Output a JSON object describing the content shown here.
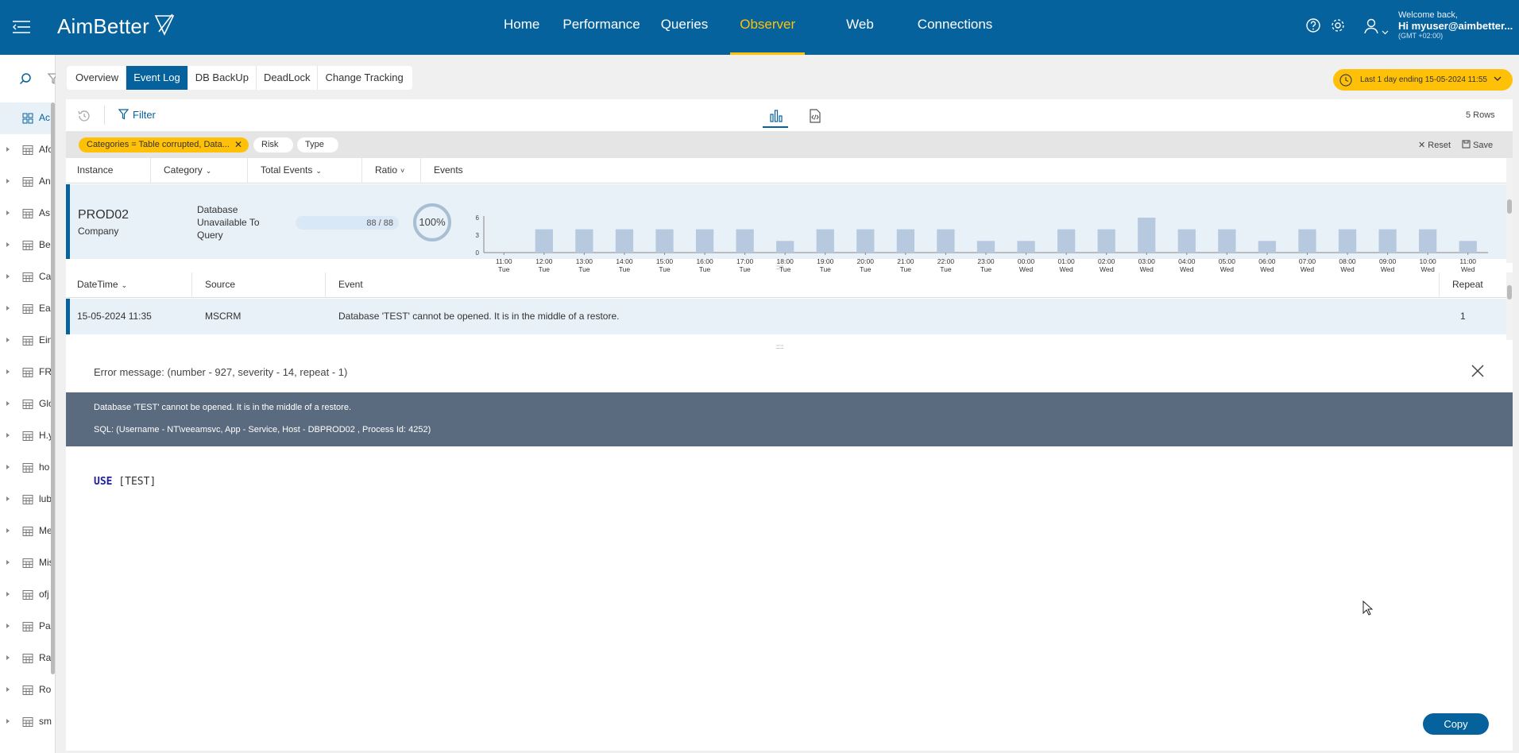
{
  "header": {
    "app_name": "AimBetter",
    "nav": [
      {
        "label": "Home",
        "active": false
      },
      {
        "label": "Performance",
        "active": false
      },
      {
        "label": "Queries",
        "active": false
      },
      {
        "label": "Observer",
        "active": true
      },
      {
        "label": "Web",
        "active": false
      },
      {
        "label": "Connections",
        "active": false
      }
    ],
    "welcome": "Welcome back,",
    "user": "Hi myuser@aimbetter...",
    "timezone": "(GMT +02:00)"
  },
  "sidebar": {
    "items": [
      {
        "label": "Ac",
        "active": true,
        "icon": "grid-icon"
      },
      {
        "label": "Afc",
        "active": false,
        "icon": "table-icon"
      },
      {
        "label": "An",
        "active": false,
        "icon": "table-icon"
      },
      {
        "label": "As",
        "active": false,
        "icon": "table-icon"
      },
      {
        "label": "Be",
        "active": false,
        "icon": "table-icon"
      },
      {
        "label": "Ca",
        "active": false,
        "icon": "table-icon"
      },
      {
        "label": "Ea",
        "active": false,
        "icon": "table-icon"
      },
      {
        "label": "Ein",
        "active": false,
        "icon": "table-icon"
      },
      {
        "label": "FR",
        "active": false,
        "icon": "table-icon"
      },
      {
        "label": "Glo",
        "active": false,
        "icon": "table-icon"
      },
      {
        "label": "H.y",
        "active": false,
        "icon": "table-icon"
      },
      {
        "label": "ho",
        "active": false,
        "icon": "table-icon"
      },
      {
        "label": "lub",
        "active": false,
        "icon": "table-icon"
      },
      {
        "label": "Me",
        "active": false,
        "icon": "table-icon"
      },
      {
        "label": "Mis",
        "active": false,
        "icon": "table-icon"
      },
      {
        "label": "ofj",
        "active": false,
        "icon": "table-icon"
      },
      {
        "label": "Pa",
        "active": false,
        "icon": "table-icon"
      },
      {
        "label": "Ra",
        "active": false,
        "icon": "table-icon"
      },
      {
        "label": "Ro",
        "active": false,
        "icon": "table-icon"
      },
      {
        "label": "sm",
        "active": false,
        "icon": "table-icon"
      }
    ]
  },
  "subtabs": [
    {
      "label": "Overview",
      "active": false
    },
    {
      "label": "Event Log",
      "active": true
    },
    {
      "label": "DB BackUp",
      "active": false
    },
    {
      "label": "DeadLock",
      "active": false
    },
    {
      "label": "Change Tracking",
      "active": false
    }
  ],
  "time_range": "Last 1 day ending  15-05-2024 11:55",
  "toolbar": {
    "filter_label": "Filter",
    "rows_count": "5 Rows"
  },
  "filters": {
    "category_chip": "Categories = Table corrupted, Data...",
    "risk_chip": "Risk",
    "type_chip": "Type",
    "reset_label": "Reset",
    "save_label": "Save"
  },
  "instance_table": {
    "columns": [
      "Instance",
      "Category",
      "Total Events",
      "Ratio",
      "Events"
    ],
    "row": {
      "instance": "PROD02",
      "company": "Company",
      "category": "Database Unavailable To Query",
      "total_events": "88 / 88",
      "total_fraction": 1.0,
      "ratio": "100%",
      "ratio_fraction": 1.0
    }
  },
  "chart_data": {
    "type": "bar",
    "categories": [
      "11:00 Tue",
      "12:00 Tue",
      "13:00 Tue",
      "14:00 Tue",
      "15:00 Tue",
      "16:00 Tue",
      "17:00 Tue",
      "18:00 Tue",
      "19:00 Tue",
      "20:00 Tue",
      "21:00 Tue",
      "22:00 Tue",
      "23:00 Tue",
      "00:00 Wed",
      "01:00 Wed",
      "02:00 Wed",
      "03:00 Wed",
      "04:00 Wed",
      "05:00 Wed",
      "06:00 Wed",
      "07:00 Wed",
      "08:00 Wed",
      "09:00 Wed",
      "10:00 Wed",
      "11:00 Wed"
    ],
    "tick_top": [
      "11:00",
      "12:00",
      "13:00",
      "14:00",
      "15:00",
      "16:00",
      "17:00",
      "18:00",
      "19:00",
      "20:00",
      "21:00",
      "22:00",
      "23:00",
      "00:00",
      "01:00",
      "02:00",
      "03:00",
      "04:00",
      "05:00",
      "06:00",
      "07:00",
      "08:00",
      "09:00",
      "10:00",
      "11:00"
    ],
    "tick_bottom": [
      "Tue",
      "Tue",
      "Tue",
      "Tue",
      "Tue",
      "Tue",
      "Tue",
      "Tue",
      "Tue",
      "Tue",
      "Tue",
      "Tue",
      "Tue",
      "Wed",
      "Wed",
      "Wed",
      "Wed",
      "Wed",
      "Wed",
      "Wed",
      "Wed",
      "Wed",
      "Wed",
      "Wed",
      "Wed"
    ],
    "values": [
      0,
      4,
      4,
      4,
      4,
      4,
      4,
      2,
      4,
      4,
      4,
      4,
      2,
      2,
      4,
      4,
      6,
      4,
      4,
      2,
      4,
      4,
      4,
      4,
      2
    ],
    "ylim": [
      0,
      6
    ],
    "yticks": [
      "0",
      "3",
      "6"
    ],
    "bar_color": "#b6c9df"
  },
  "event_table": {
    "columns": [
      "DateTime",
      "Source",
      "Event",
      "Repeat"
    ],
    "row": {
      "datetime": "15-05-2024 11:35",
      "source": "MSCRM",
      "event": "Database 'TEST' cannot be opened. It is in the middle of a restore.",
      "repeat": "1"
    }
  },
  "detail": {
    "title": "Error message: (number - 927, severity - 14, repeat - 1)",
    "message": "Database 'TEST' cannot be opened. It is in the middle of a restore.",
    "sql_info": "SQL: (Username - NT\\veeamsvc, App - Service, Host - DBPROD02 , Process Id: 4252)",
    "code_keyword": "USE",
    "code_rest": " [TEST]",
    "copy_label": "Copy"
  },
  "colors": {
    "brand": "#05629c",
    "accent": "#ffc107",
    "error_box": "#5b6b7f"
  }
}
